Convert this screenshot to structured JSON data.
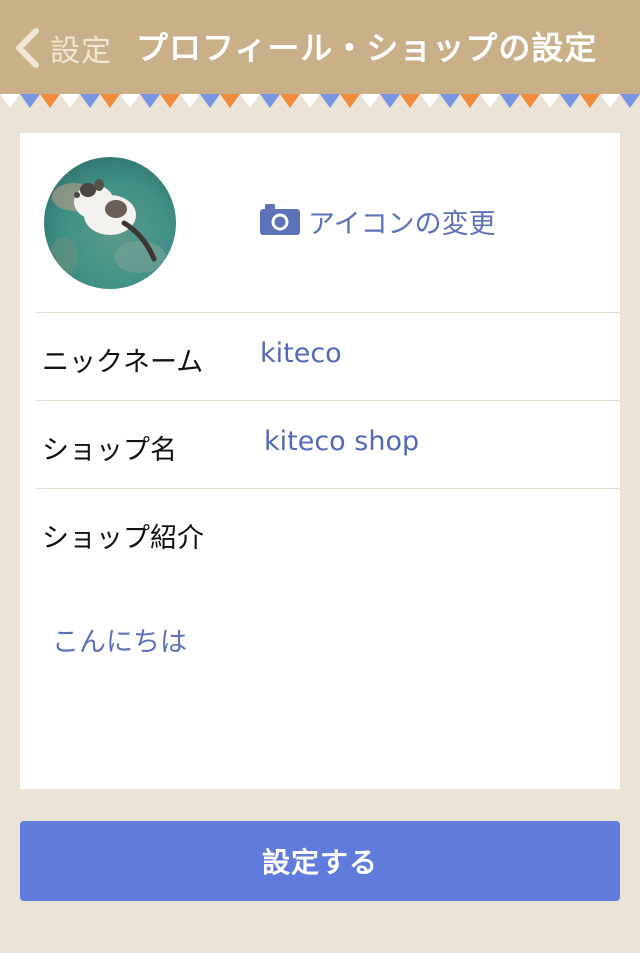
{
  "nav": {
    "back_label": "設定",
    "title": "プロフィール・ショップの設定"
  },
  "theme": {
    "nav_bg": "#c9b089",
    "page_bg": "#ebe3d6",
    "accent": "#5f7bdc",
    "link": "#5d72b9",
    "bunting_colors": [
      "#ffffff",
      "#7a95e0",
      "#f08a3c"
    ]
  },
  "profile": {
    "change_icon_label": "アイコンの変更",
    "avatar_icon": "cat-photo-avatar",
    "camera_icon": "camera-icon"
  },
  "fields": {
    "nickname_label": "ニックネーム",
    "nickname_value": "kiteco",
    "shop_name_label": "ショップ名",
    "shop_name_value": "kiteco shop",
    "shop_intro_label": "ショップ紹介",
    "shop_intro_value": "こんにちは"
  },
  "submit_label": "設定する"
}
